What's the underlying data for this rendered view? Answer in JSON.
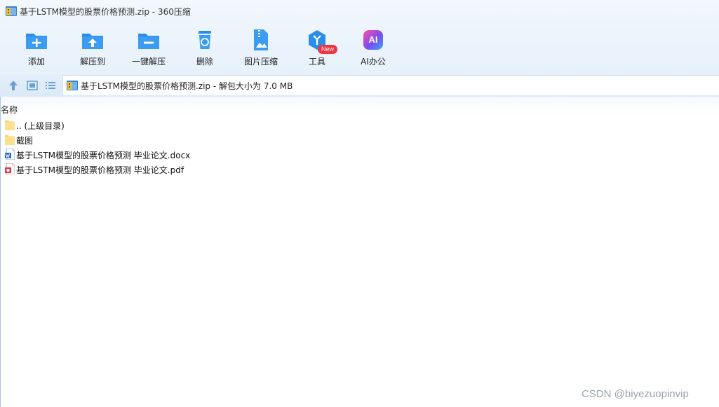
{
  "window": {
    "title": "基于LSTM模型的股票价格预测.zip - 360压缩"
  },
  "toolbar": {
    "items": [
      {
        "label": "添加",
        "icon": "add-icon"
      },
      {
        "label": "解压到",
        "icon": "extract-to-icon"
      },
      {
        "label": "一键解压",
        "icon": "one-click-extract-icon"
      },
      {
        "label": "删除",
        "icon": "delete-icon"
      },
      {
        "label": "图片压缩",
        "icon": "image-compress-icon"
      },
      {
        "label": "工具",
        "icon": "tools-icon",
        "badge": "New"
      },
      {
        "label": "AI办公",
        "icon": "ai-office-icon",
        "glyph": "AI"
      }
    ]
  },
  "navbar": {
    "path": "基于LSTM模型的股票价格预测.zip - 解包大小为 7.0 MB"
  },
  "columns": {
    "name": "名称"
  },
  "files": [
    {
      "name": ".. (上级目录)",
      "type": "folder"
    },
    {
      "name": "截图",
      "type": "folder"
    },
    {
      "name": "基于LSTM模型的股票价格预测 毕业论文.docx",
      "type": "docx"
    },
    {
      "name": "基于LSTM模型的股票价格预测 毕业论文.pdf",
      "type": "pdf"
    }
  ],
  "watermark": "CSDN @biyezuopinvip",
  "colors": {
    "accent": "#2a8de8",
    "badge": "#f5333f",
    "ai": "#7a4cf0"
  }
}
